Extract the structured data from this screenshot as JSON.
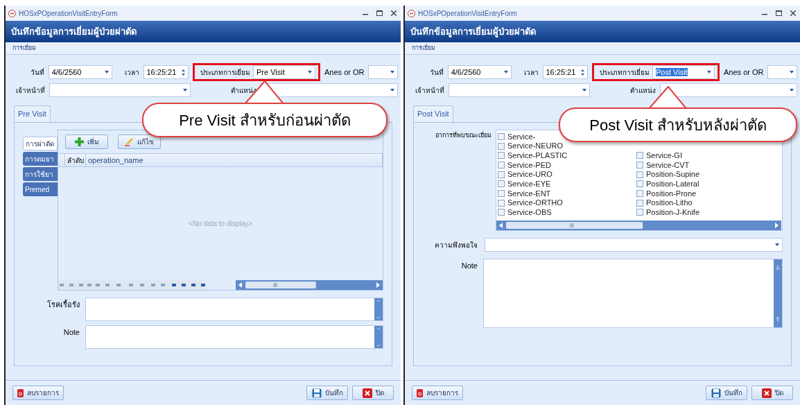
{
  "windows": [
    {
      "kind": "pre",
      "title": "HOSxPOperationVisitEntryForm",
      "header": "บันทึกข้อมูลการเยี่ยมผู้ป่วยผ่าตัด",
      "group_label": "การเยี่ยม",
      "date_label": "วันที่",
      "date": "4/6/2560",
      "time_label": "เวลา",
      "time": "16:25:21",
      "visit_type_label": "ประเภทการเยี่ยม",
      "visit_type": "Pre Visit",
      "visit_type_text_selected": false,
      "highlighted": true,
      "anes_label": "Anes or OR",
      "staff_label": "เจ้าหน้าที่",
      "position_label": "ตำแหน่ง",
      "tab": {
        "label": "Pre Visit",
        "selected": true
      },
      "callout": "Pre Visit สำหรับก่อนผ่าตัด",
      "side_tabs": [
        {
          "label": "การผ่าตัด",
          "selected": true
        },
        {
          "label": "การดมยา",
          "selected": false
        },
        {
          "label": "การใช้ยา",
          "selected": false
        },
        {
          "label": "Premed",
          "selected": false
        }
      ],
      "grid_buttons": [
        "เพิ่ม",
        "แก้ไข"
      ],
      "columns": [
        "ลำดับ",
        "operation_name"
      ],
      "empty_text": "<No data to display>",
      "memo_fields": [
        "โรคเรื้อรัง",
        "Note"
      ],
      "buttons": {
        "delete": "ลบรายการ",
        "save": "บันทึก",
        "close": "ปิด"
      }
    },
    {
      "kind": "post",
      "title": "HOSxPOperationVisitEntryForm",
      "header": "บันทึกข้อมูลการเยี่ยมผู้ป่วยผ่าตัด",
      "group_label": "การเยี่ยม",
      "date_label": "วันที่",
      "date": "4/6/2560",
      "time_label": "เวลา",
      "time": "16:25:21",
      "visit_type_label": "ประเภทการเยี่ยม",
      "visit_type": "Post Visit",
      "visit_type_text_selected": true,
      "highlighted": true,
      "anes_label": "Anes or OR",
      "staff_label": "เจ้าหน้าที่",
      "position_label": "ตำแหน่ง",
      "tab": {
        "label": "Post Visit",
        "selected": true
      },
      "callout": "Post Visit สำหรับหลังผ่าตัด",
      "symptoms_label": "อาการที่พบขณะเยี่ยม",
      "checklist_left": [
        {
          "label": "Service-",
          "checked": false
        },
        {
          "label": "Service-NEURO",
          "checked": false
        },
        {
          "label": "Service-PLASTIC",
          "checked": false
        },
        {
          "label": "Service-PED",
          "checked": false
        },
        {
          "label": "Service-URO",
          "checked": false
        },
        {
          "label": "Service-EYE",
          "checked": false
        },
        {
          "label": "Service-ENT",
          "checked": false
        },
        {
          "label": "Service-ORTHO",
          "checked": false
        },
        {
          "label": "Service-OBS",
          "checked": false
        }
      ],
      "checklist_right": [
        {
          "label": "Service-GI",
          "checked": false
        },
        {
          "label": "Service-CVT",
          "checked": false
        },
        {
          "label": "Position-Supine",
          "checked": false
        },
        {
          "label": "Position-Lateral",
          "checked": false
        },
        {
          "label": "Position-Prone",
          "checked": false
        },
        {
          "label": "Position-Litho",
          "checked": false
        },
        {
          "label": "Position-J-Knife",
          "checked": false
        }
      ],
      "satisfaction_label": "ความพึงพอใจ",
      "note_label": "Note",
      "buttons": {
        "delete": "ลบรายการ",
        "save": "บันทึก",
        "close": "ปิด"
      }
    }
  ]
}
